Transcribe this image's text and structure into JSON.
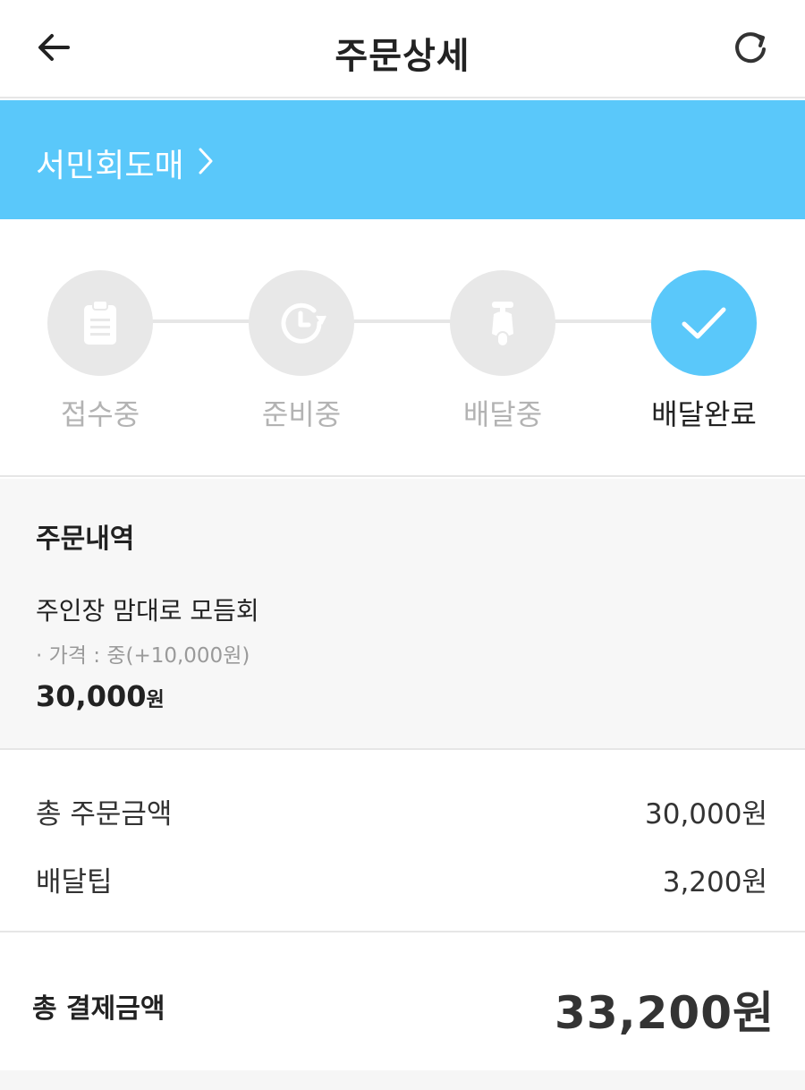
{
  "header": {
    "title": "주문상세",
    "back_icon": "arrow-left-icon",
    "refresh_icon": "refresh-icon"
  },
  "store": {
    "name": "서민회도매"
  },
  "status": {
    "steps": [
      {
        "label": "접수중",
        "icon": "clipboard-icon",
        "active": false
      },
      {
        "label": "준비중",
        "icon": "clock-icon",
        "active": false
      },
      {
        "label": "배달중",
        "icon": "scooter-icon",
        "active": false
      },
      {
        "label": "배달완료",
        "icon": "check-icon",
        "active": true
      }
    ],
    "accent_color": "#5ac8fa",
    "inactive_color": "#e8e8e8"
  },
  "order": {
    "heading": "주문내역",
    "item_name": "주인장 맘대로 모듬회",
    "option": "· 가격 : 중(+10,000원)",
    "price_value": "30,000",
    "price_unit": "원"
  },
  "totals": {
    "order_total_label": "총 주문금액",
    "order_total_value": "30,000원",
    "delivery_tip_label": "배달팁",
    "delivery_tip_value": "3,200원"
  },
  "payment": {
    "label": "총 결제금액",
    "amount": "33,200원"
  }
}
